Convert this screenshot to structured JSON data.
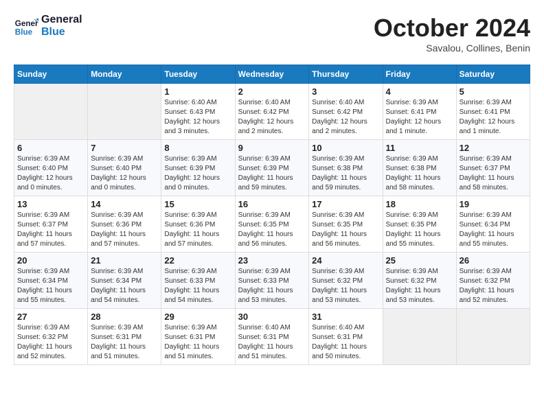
{
  "header": {
    "logo_line1": "General",
    "logo_line2": "Blue",
    "month_title": "October 2024",
    "location": "Savalou, Collines, Benin"
  },
  "weekdays": [
    "Sunday",
    "Monday",
    "Tuesday",
    "Wednesday",
    "Thursday",
    "Friday",
    "Saturday"
  ],
  "weeks": [
    [
      {
        "day": "",
        "info": ""
      },
      {
        "day": "",
        "info": ""
      },
      {
        "day": "1",
        "info": "Sunrise: 6:40 AM\nSunset: 6:43 PM\nDaylight: 12 hours and 3 minutes."
      },
      {
        "day": "2",
        "info": "Sunrise: 6:40 AM\nSunset: 6:42 PM\nDaylight: 12 hours and 2 minutes."
      },
      {
        "day": "3",
        "info": "Sunrise: 6:40 AM\nSunset: 6:42 PM\nDaylight: 12 hours and 2 minutes."
      },
      {
        "day": "4",
        "info": "Sunrise: 6:39 AM\nSunset: 6:41 PM\nDaylight: 12 hours and 1 minute."
      },
      {
        "day": "5",
        "info": "Sunrise: 6:39 AM\nSunset: 6:41 PM\nDaylight: 12 hours and 1 minute."
      }
    ],
    [
      {
        "day": "6",
        "info": "Sunrise: 6:39 AM\nSunset: 6:40 PM\nDaylight: 12 hours and 0 minutes."
      },
      {
        "day": "7",
        "info": "Sunrise: 6:39 AM\nSunset: 6:40 PM\nDaylight: 12 hours and 0 minutes."
      },
      {
        "day": "8",
        "info": "Sunrise: 6:39 AM\nSunset: 6:39 PM\nDaylight: 12 hours and 0 minutes."
      },
      {
        "day": "9",
        "info": "Sunrise: 6:39 AM\nSunset: 6:39 PM\nDaylight: 11 hours and 59 minutes."
      },
      {
        "day": "10",
        "info": "Sunrise: 6:39 AM\nSunset: 6:38 PM\nDaylight: 11 hours and 59 minutes."
      },
      {
        "day": "11",
        "info": "Sunrise: 6:39 AM\nSunset: 6:38 PM\nDaylight: 11 hours and 58 minutes."
      },
      {
        "day": "12",
        "info": "Sunrise: 6:39 AM\nSunset: 6:37 PM\nDaylight: 11 hours and 58 minutes."
      }
    ],
    [
      {
        "day": "13",
        "info": "Sunrise: 6:39 AM\nSunset: 6:37 PM\nDaylight: 11 hours and 57 minutes."
      },
      {
        "day": "14",
        "info": "Sunrise: 6:39 AM\nSunset: 6:36 PM\nDaylight: 11 hours and 57 minutes."
      },
      {
        "day": "15",
        "info": "Sunrise: 6:39 AM\nSunset: 6:36 PM\nDaylight: 11 hours and 57 minutes."
      },
      {
        "day": "16",
        "info": "Sunrise: 6:39 AM\nSunset: 6:35 PM\nDaylight: 11 hours and 56 minutes."
      },
      {
        "day": "17",
        "info": "Sunrise: 6:39 AM\nSunset: 6:35 PM\nDaylight: 11 hours and 56 minutes."
      },
      {
        "day": "18",
        "info": "Sunrise: 6:39 AM\nSunset: 6:35 PM\nDaylight: 11 hours and 55 minutes."
      },
      {
        "day": "19",
        "info": "Sunrise: 6:39 AM\nSunset: 6:34 PM\nDaylight: 11 hours and 55 minutes."
      }
    ],
    [
      {
        "day": "20",
        "info": "Sunrise: 6:39 AM\nSunset: 6:34 PM\nDaylight: 11 hours and 55 minutes."
      },
      {
        "day": "21",
        "info": "Sunrise: 6:39 AM\nSunset: 6:34 PM\nDaylight: 11 hours and 54 minutes."
      },
      {
        "day": "22",
        "info": "Sunrise: 6:39 AM\nSunset: 6:33 PM\nDaylight: 11 hours and 54 minutes."
      },
      {
        "day": "23",
        "info": "Sunrise: 6:39 AM\nSunset: 6:33 PM\nDaylight: 11 hours and 53 minutes."
      },
      {
        "day": "24",
        "info": "Sunrise: 6:39 AM\nSunset: 6:32 PM\nDaylight: 11 hours and 53 minutes."
      },
      {
        "day": "25",
        "info": "Sunrise: 6:39 AM\nSunset: 6:32 PM\nDaylight: 11 hours and 53 minutes."
      },
      {
        "day": "26",
        "info": "Sunrise: 6:39 AM\nSunset: 6:32 PM\nDaylight: 11 hours and 52 minutes."
      }
    ],
    [
      {
        "day": "27",
        "info": "Sunrise: 6:39 AM\nSunset: 6:32 PM\nDaylight: 11 hours and 52 minutes."
      },
      {
        "day": "28",
        "info": "Sunrise: 6:39 AM\nSunset: 6:31 PM\nDaylight: 11 hours and 51 minutes."
      },
      {
        "day": "29",
        "info": "Sunrise: 6:39 AM\nSunset: 6:31 PM\nDaylight: 11 hours and 51 minutes."
      },
      {
        "day": "30",
        "info": "Sunrise: 6:40 AM\nSunset: 6:31 PM\nDaylight: 11 hours and 51 minutes."
      },
      {
        "day": "31",
        "info": "Sunrise: 6:40 AM\nSunset: 6:31 PM\nDaylight: 11 hours and 50 minutes."
      },
      {
        "day": "",
        "info": ""
      },
      {
        "day": "",
        "info": ""
      }
    ]
  ]
}
